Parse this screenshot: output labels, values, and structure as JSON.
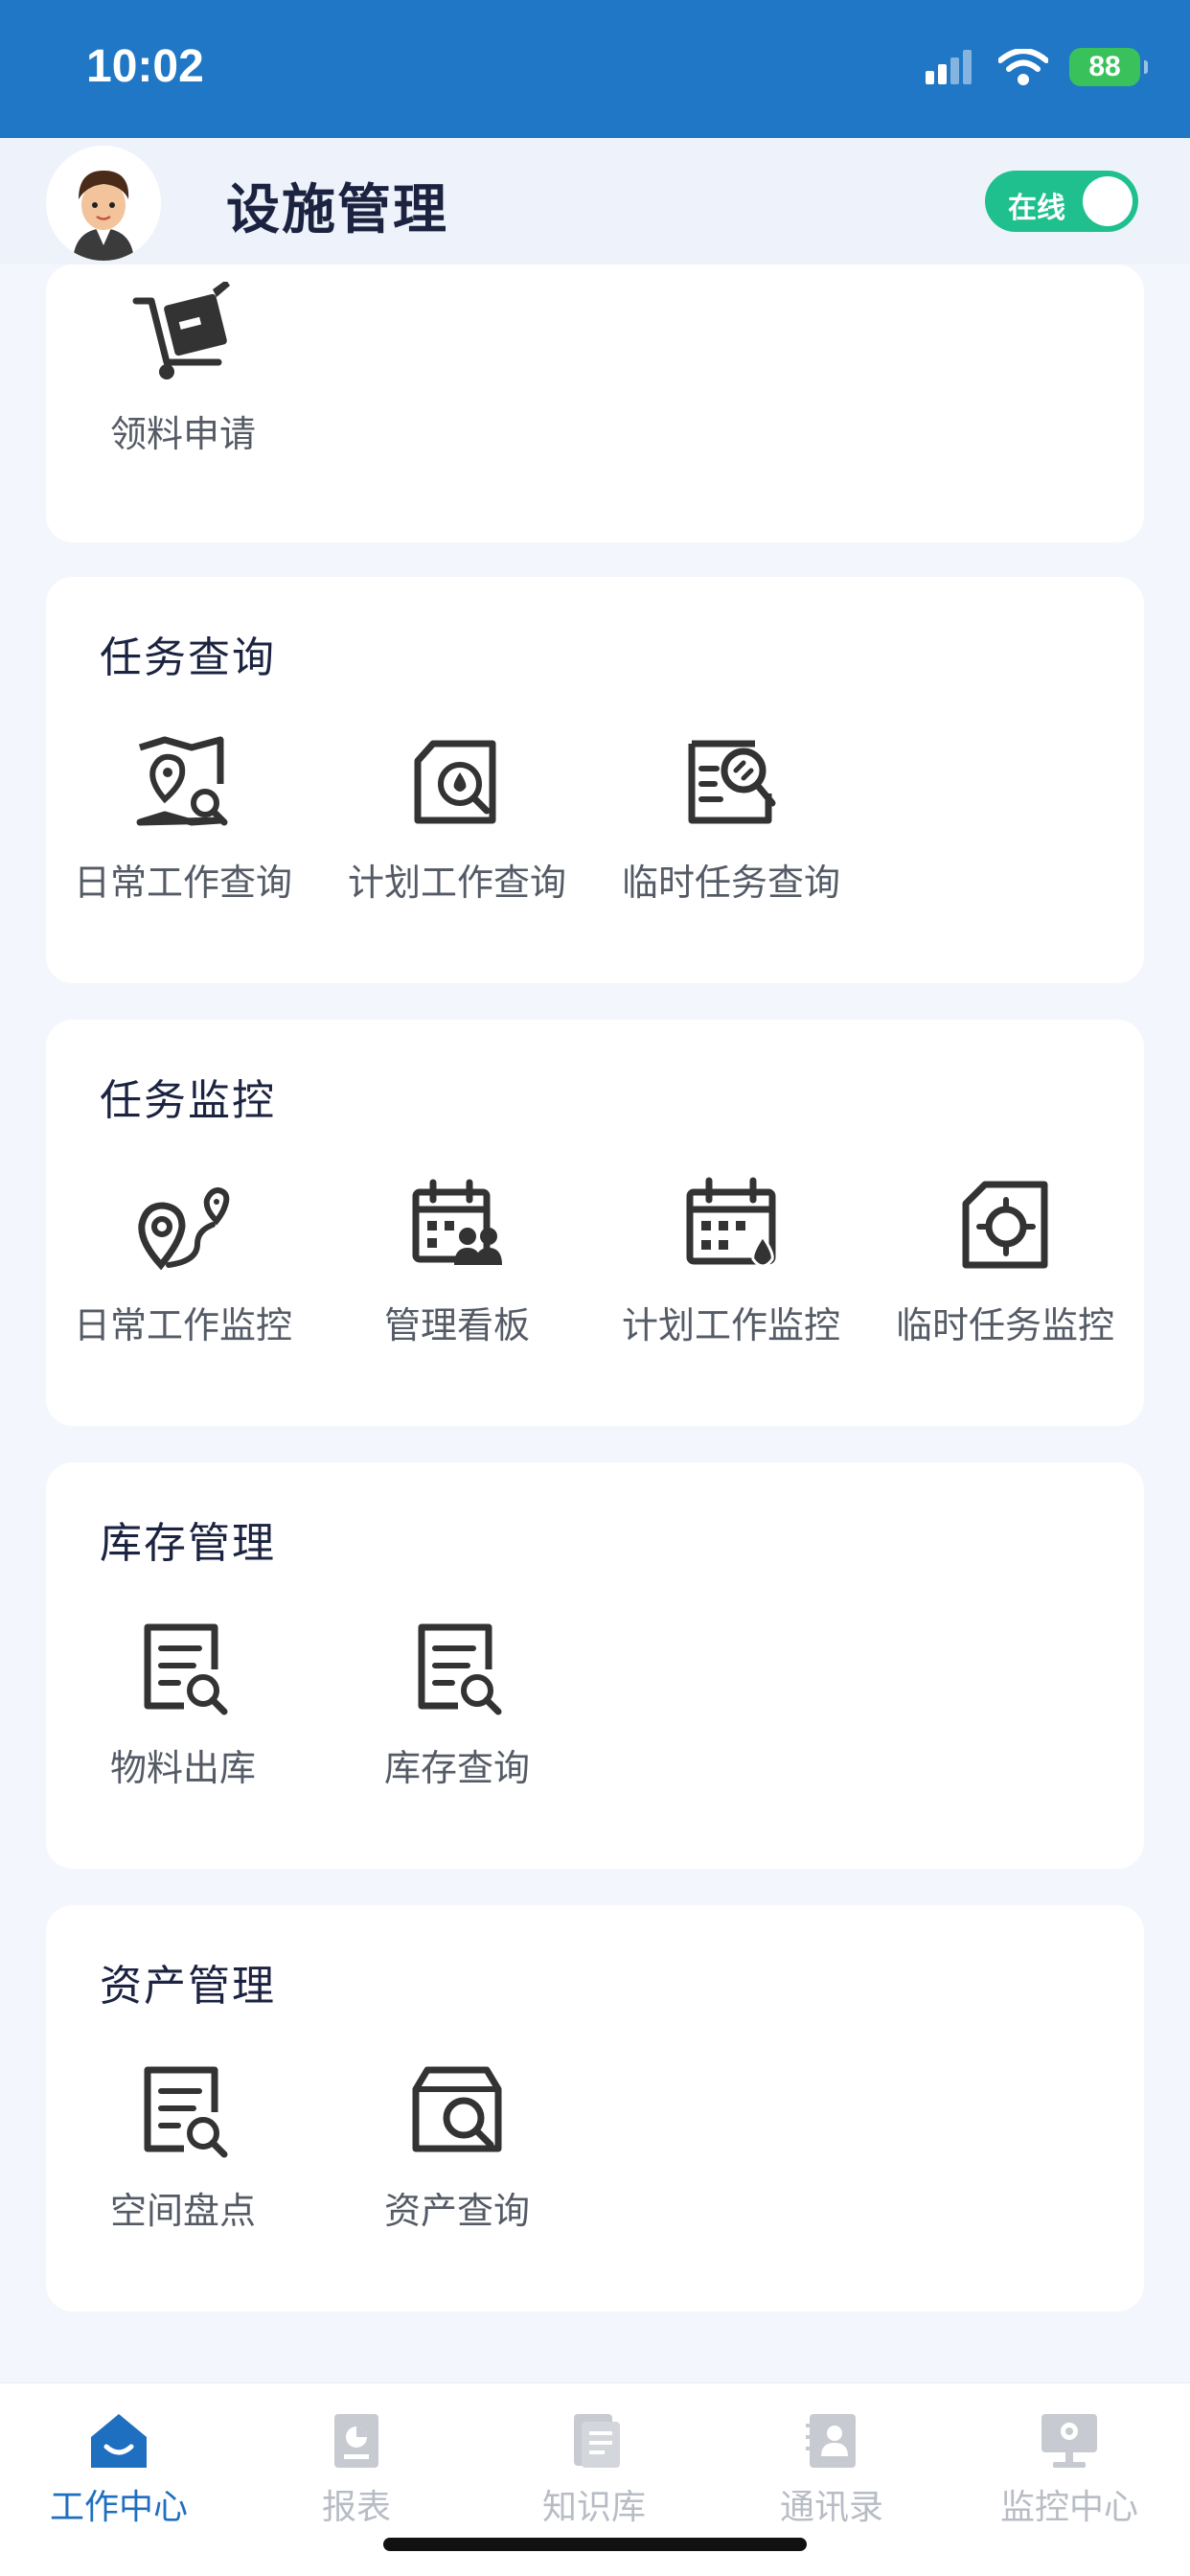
{
  "status_bar": {
    "time": "10:02",
    "battery": "88"
  },
  "header": {
    "title": "设施管理",
    "online_label": "在线"
  },
  "sections": {
    "top": {
      "items": [
        "领料申请"
      ]
    },
    "task_query": {
      "title": "任务查询",
      "items": [
        "日常工作查询",
        "计划工作查询",
        "临时任务查询"
      ]
    },
    "task_monitor": {
      "title": "任务监控",
      "items": [
        "日常工作监控",
        "管理看板",
        "计划工作监控",
        "临时任务监控"
      ]
    },
    "inventory": {
      "title": "库存管理",
      "items": [
        "物料出库",
        "库存查询"
      ]
    },
    "assets": {
      "title": "资产管理",
      "items": [
        "空间盘点",
        "资产查询"
      ]
    }
  },
  "tabbar": {
    "items": [
      "工作中心",
      "报表",
      "知识库",
      "通讯录",
      "监控中心"
    ],
    "active": "工作中心"
  },
  "colors": {
    "primary": "#2077c5",
    "online": "#1fc08d",
    "active_tab": "#1f6fc0",
    "inactive_tab": "#b8bcc4"
  }
}
